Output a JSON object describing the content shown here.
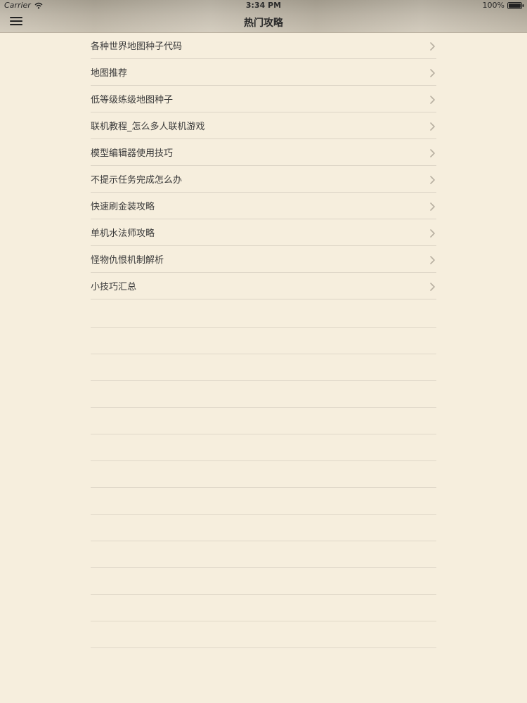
{
  "status_bar": {
    "carrier": "Carrier",
    "time": "3:34 PM",
    "battery": "100%"
  },
  "nav": {
    "title": "热门攻略",
    "menu_icon": "hamburger-icon"
  },
  "list": {
    "items": [
      {
        "label": "各种世界地图种子代码"
      },
      {
        "label": "地图推荐"
      },
      {
        "label": "低等级练级地图种子"
      },
      {
        "label": "联机教程_怎么多人联机游戏"
      },
      {
        "label": "模型编辑器使用技巧"
      },
      {
        "label": "不提示任务完成怎么办"
      },
      {
        "label": "快速刷金装攻略"
      },
      {
        "label": "单机水法师攻略"
      },
      {
        "label": "怪物仇恨机制解析"
      },
      {
        "label": "小技巧汇总"
      }
    ]
  },
  "colors": {
    "background": "#f6eedd",
    "separator": "#ddd5c6",
    "chevron": "#b8b0a2"
  }
}
